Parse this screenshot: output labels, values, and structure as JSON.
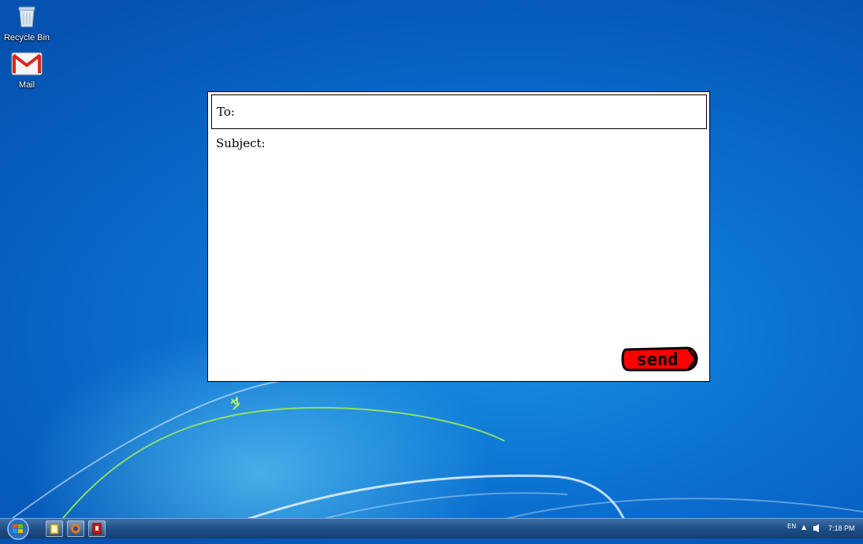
{
  "desktop": {
    "icons": [
      {
        "label": "Recycle Bin",
        "icon": "recycle-bin-icon"
      },
      {
        "label": "Mail",
        "icon": "gmail-icon"
      }
    ]
  },
  "compose": {
    "to_label": "To:",
    "subject_label": "Subject:",
    "send_label": "send",
    "send_color": "#ff0000"
  },
  "taskbar": {
    "start_icon": "windows-start-orb",
    "pinned": [
      "file-explorer-icon",
      "firefox-icon",
      "app-icon-red"
    ],
    "tray": {
      "language": "EN",
      "clock": "7:18 PM"
    }
  }
}
